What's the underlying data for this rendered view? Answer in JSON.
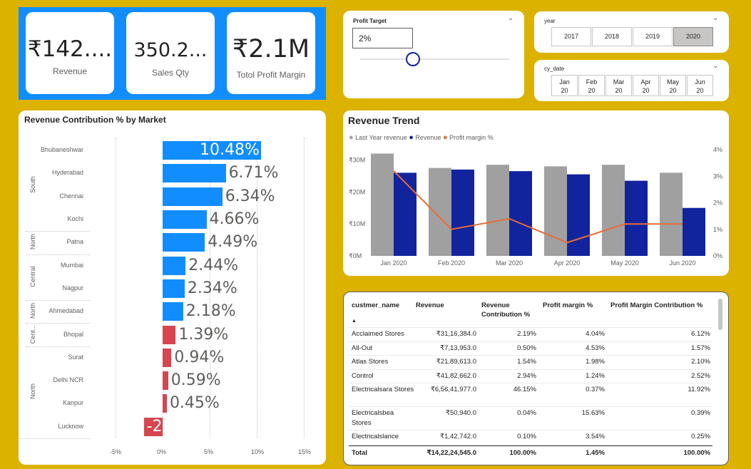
{
  "kpis": [
    {
      "value": "₹142....",
      "label": "Revenue"
    },
    {
      "value": "350.2...",
      "label": "Sales Qty"
    },
    {
      "value": "₹2.1M",
      "label": "Totol Profit Margin"
    }
  ],
  "profit_target": {
    "title": "Profit Target",
    "value": "2%",
    "slider_fraction": 0.5
  },
  "year_slicer": {
    "title": "year",
    "options": [
      "2017",
      "2018",
      "2019",
      "2020"
    ],
    "selected": "2020"
  },
  "date_slicer": {
    "title": "cy_date",
    "options": [
      [
        "Jan",
        "20"
      ],
      [
        "Feb",
        "20"
      ],
      [
        "Mar",
        "20"
      ],
      [
        "Apr",
        "20"
      ],
      [
        "May",
        "20"
      ],
      [
        "Jun",
        "20"
      ]
    ]
  },
  "colors": {
    "positive_bar": "#118dff",
    "negative_bar": "#d64550",
    "last_year": "#a0a0a0",
    "revenue": "#12239e",
    "profit_line": "#e66c37"
  },
  "chart_data": [
    {
      "type": "bar",
      "title": "Revenue Contribution % by Market",
      "orientation": "horizontal",
      "categories": [
        "Bhubaneshwar",
        "Hyderabad",
        "Chennai",
        "Kochi",
        "Patna",
        "Mumbai",
        "Nagpur",
        "Ahmedabad",
        "Bhopal",
        "Surat",
        "Delhi NCR",
        "Kanpur",
        "Lucknow"
      ],
      "groups": [
        {
          "name": "South",
          "members": [
            "Bhubaneshwar",
            "Hyderabad",
            "Chennai",
            "Kochi"
          ]
        },
        {
          "name": "North",
          "members": [
            "Patna"
          ]
        },
        {
          "name": "Central",
          "members": [
            "Mumbai",
            "Nagpur"
          ]
        },
        {
          "name": "North",
          "members": [
            "Ahmedabad"
          ]
        },
        {
          "name": "Cent...",
          "members": [
            "Bhopal"
          ]
        },
        {
          "name": "North",
          "members": [
            "Surat",
            "Delhi NCR",
            "Kanpur",
            "Lucknow"
          ]
        }
      ],
      "values": [
        10.48,
        6.71,
        6.34,
        4.66,
        4.49,
        2.44,
        2.34,
        2.18,
        1.39,
        0.94,
        0.59,
        0.45,
        -2.0
      ],
      "data_labels": [
        "10.48%",
        "6.71%",
        "6.34%",
        "4.66%",
        "4.49%",
        "2.44%",
        "2.34%",
        "2.18%",
        "1.39%",
        "0.94%",
        "0.59%",
        "0.45%",
        "-2."
      ],
      "xticks": [
        "-5%",
        "0%",
        "5%",
        "10%",
        "15%"
      ],
      "xlim": [
        -5,
        15
      ]
    },
    {
      "type": "bar",
      "title": "Revenue Trend",
      "categories": [
        "Jan 2020",
        "Feb 2020",
        "Mar 2020",
        "Apr 2020",
        "May 2020",
        "Jun 2020"
      ],
      "series": [
        {
          "name": "Last Year revenue",
          "values": [
            32,
            27.5,
            28.5,
            28,
            28.5,
            26
          ]
        },
        {
          "name": "Revenue",
          "values": [
            26,
            27,
            26.5,
            25.5,
            23.5,
            15
          ]
        },
        {
          "name": "Profit margin %",
          "kind": "line",
          "axis": "right",
          "values": [
            3.2,
            1.0,
            1.4,
            0.5,
            1.2,
            1.2
          ]
        }
      ],
      "yticks_left": [
        "₹30M",
        "₹20M",
        "₹10M",
        "₹0M"
      ],
      "yticks_right": [
        "4%",
        "3%",
        "2%",
        "1%",
        "0%"
      ],
      "ylim": [
        0,
        35
      ],
      "ylim_right": [
        0,
        4
      ],
      "legend": "top-left"
    }
  ],
  "table": {
    "columns": [
      "custmer_name",
      "Revenue",
      "Revenue Contribution %",
      "Profit margin %",
      "Profit Margin Contribution %"
    ],
    "rows": [
      [
        "Acclaimed Stores",
        "₹31,16,384.0",
        "2.19%",
        "4.04%",
        "6.12%"
      ],
      [
        "All-Out",
        "₹7,13,953.0",
        "0.50%",
        "4.53%",
        "1.57%"
      ],
      [
        "Atlas Stores",
        "₹21,89,613.0",
        "1.54%",
        "1.98%",
        "2.10%"
      ],
      [
        "Control",
        "₹41,82,662.0",
        "2.94%",
        "1.24%",
        "2.52%"
      ],
      [
        "Electricalsara Stores",
        "₹6,56,41,977.0",
        "46.15%",
        "0.37%",
        "11.92%"
      ],
      [
        "Electricalsbea Stores",
        "₹50,940.0",
        "0.04%",
        "15.63%",
        "0.39%"
      ],
      [
        "Electricalslance",
        "₹1,42,742.0",
        "0.10%",
        "3.54%",
        "0.25%"
      ]
    ],
    "total": [
      "Total",
      "₹14,22,24,545.0",
      "100.00%",
      "1.45%",
      "100.00%"
    ]
  }
}
